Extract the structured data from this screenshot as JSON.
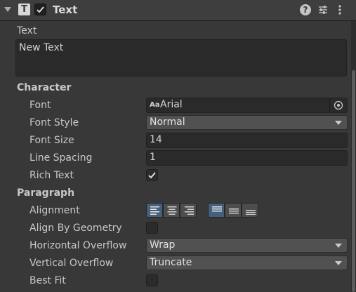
{
  "header": {
    "title": "Text",
    "component_icon_letter": "T",
    "enabled": true,
    "icons": [
      "fold-icon",
      "text-component-icon",
      "help-icon",
      "presets-icon",
      "context-menu-icon"
    ]
  },
  "text_field": {
    "label": "Text",
    "value": "New Text"
  },
  "character": {
    "heading": "Character",
    "font": {
      "label": "Font",
      "aa_glyph": "Aa",
      "value": "Arial"
    },
    "font_style": {
      "label": "Font Style",
      "value": "Normal"
    },
    "font_size": {
      "label": "Font Size",
      "value": "14"
    },
    "line_spacing": {
      "label": "Line Spacing",
      "value": "1"
    },
    "rich_text": {
      "label": "Rich Text",
      "checked": true
    }
  },
  "paragraph": {
    "heading": "Paragraph",
    "alignment": {
      "label": "Alignment",
      "horizontal": [
        "left",
        "center",
        "right"
      ],
      "horizontal_selected": "left",
      "vertical": [
        "top",
        "middle",
        "bottom"
      ],
      "vertical_selected": "top"
    },
    "align_by_geometry": {
      "label": "Align By Geometry",
      "checked": false
    },
    "horizontal_overflow": {
      "label": "Horizontal Overflow",
      "value": "Wrap"
    },
    "vertical_overflow": {
      "label": "Vertical Overflow",
      "value": "Truncate"
    },
    "best_fit": {
      "label": "Best Fit",
      "checked": false
    }
  },
  "colors": {
    "background": "#383838",
    "header": "#3e3e3e",
    "field": "#2a2a2a",
    "dropdown": "#515151",
    "active_toggle": "#46607c"
  }
}
